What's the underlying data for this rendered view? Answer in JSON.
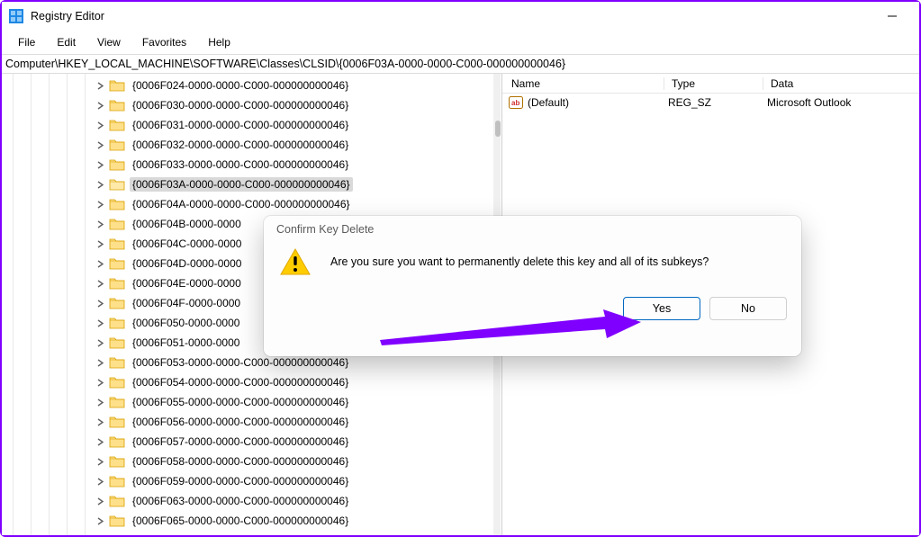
{
  "window": {
    "title": "Registry Editor"
  },
  "menu": {
    "file": "File",
    "edit": "Edit",
    "view": "View",
    "favorites": "Favorites",
    "help": "Help"
  },
  "address": "Computer\\HKEY_LOCAL_MACHINE\\SOFTWARE\\Classes\\CLSID\\{0006F03A-0000-0000-C000-000000000046}",
  "tree": {
    "items": [
      {
        "label": "{0006F024-0000-0000-C000-000000000046}",
        "selected": false
      },
      {
        "label": "{0006F030-0000-0000-C000-000000000046}",
        "selected": false
      },
      {
        "label": "{0006F031-0000-0000-C000-000000000046}",
        "selected": false
      },
      {
        "label": "{0006F032-0000-0000-C000-000000000046}",
        "selected": false
      },
      {
        "label": "{0006F033-0000-0000-C000-000000000046}",
        "selected": false
      },
      {
        "label": "{0006F03A-0000-0000-C000-000000000046}",
        "selected": true
      },
      {
        "label": "{0006F04A-0000-0000-C000-000000000046}",
        "selected": false
      },
      {
        "label": "{0006F04B-0000-0000",
        "selected": false
      },
      {
        "label": "{0006F04C-0000-0000",
        "selected": false
      },
      {
        "label": "{0006F04D-0000-0000",
        "selected": false
      },
      {
        "label": "{0006F04E-0000-0000",
        "selected": false
      },
      {
        "label": "{0006F04F-0000-0000",
        "selected": false
      },
      {
        "label": "{0006F050-0000-0000",
        "selected": false
      },
      {
        "label": "{0006F051-0000-0000",
        "selected": false
      },
      {
        "label": "{0006F053-0000-0000-C000-000000000046}",
        "selected": false
      },
      {
        "label": "{0006F054-0000-0000-C000-000000000046}",
        "selected": false
      },
      {
        "label": "{0006F055-0000-0000-C000-000000000046}",
        "selected": false
      },
      {
        "label": "{0006F056-0000-0000-C000-000000000046}",
        "selected": false
      },
      {
        "label": "{0006F057-0000-0000-C000-000000000046}",
        "selected": false
      },
      {
        "label": "{0006F058-0000-0000-C000-000000000046}",
        "selected": false
      },
      {
        "label": "{0006F059-0000-0000-C000-000000000046}",
        "selected": false
      },
      {
        "label": "{0006F063-0000-0000-C000-000000000046}",
        "selected": false
      },
      {
        "label": "{0006F065-0000-0000-C000-000000000046}",
        "selected": false
      }
    ]
  },
  "values": {
    "headers": {
      "name": "Name",
      "type": "Type",
      "data": "Data"
    },
    "rows": [
      {
        "name": "(Default)",
        "type": "REG_SZ",
        "data": "Microsoft Outlook"
      }
    ]
  },
  "dialog": {
    "title": "Confirm Key Delete",
    "message": "Are you sure you want to permanently delete this key and all of its subkeys?",
    "yes": "Yes",
    "no": "No"
  }
}
